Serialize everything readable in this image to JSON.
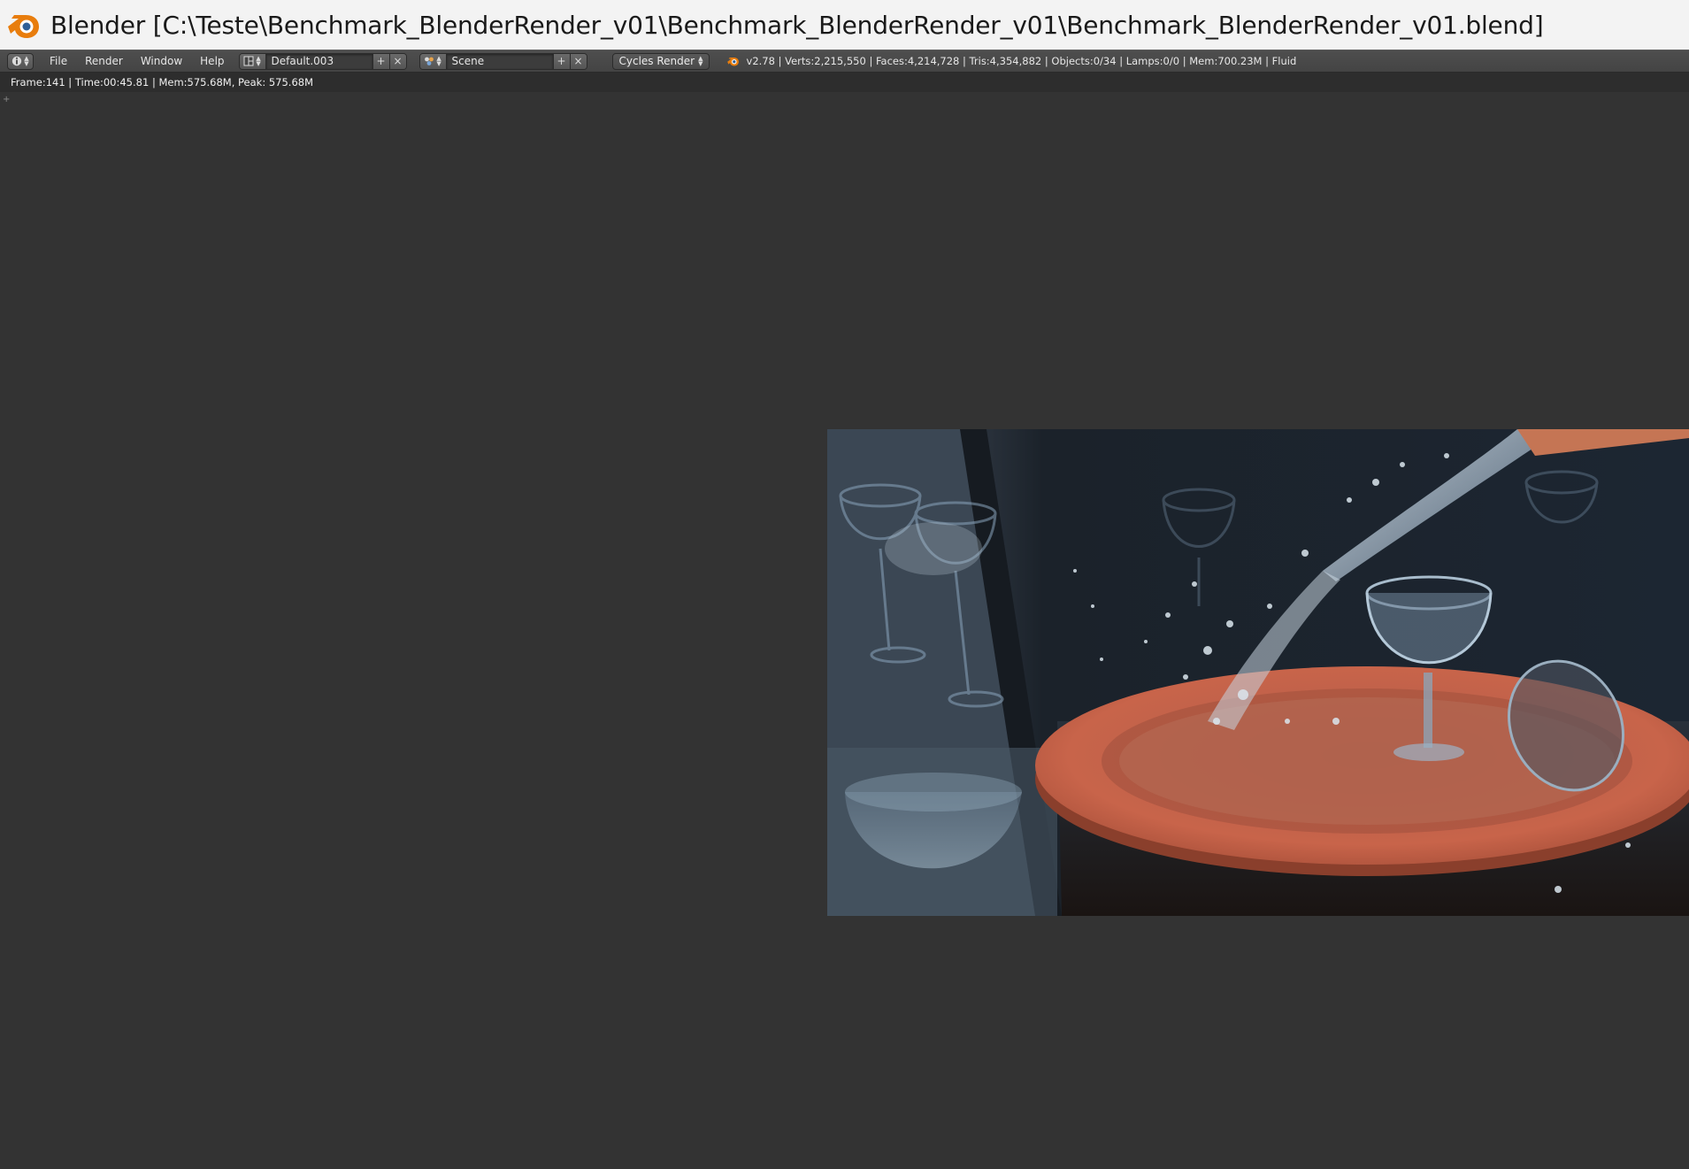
{
  "window": {
    "title": "Blender [C:\\Teste\\Benchmark_BlenderRender_v01\\Benchmark_BlenderRender_v01\\Benchmark_BlenderRender_v01.blend]",
    "icon": "blender-logo-icon"
  },
  "header": {
    "editor_type_icon": "info-editor-icon",
    "menus": [
      "File",
      "Render",
      "Window",
      "Help"
    ],
    "screen_layout": {
      "icon": "screen-layout-icon",
      "value": "Default.003"
    },
    "scene": {
      "icon": "scene-icon",
      "value": "Scene"
    },
    "render_engine": "Cycles Render",
    "stats": "v2.78 | Verts:2,215,550 | Faces:4,214,728 | Tris:4,354,882 | Objects:0/34 | Lamps:0/0 | Mem:700.23M | Fluid"
  },
  "render_status": "Frame:141 | Time:00:45.81 | Mem:575.68M, Peak: 575.68M",
  "render_result": {
    "description_icon": "render-result-image",
    "colors": {
      "plate": "#c8644a",
      "background": "#1e2a38",
      "glass": "#8aa4bc"
    }
  },
  "colors": {
    "titlebar_bg": "#f3f3f3",
    "header_bg": "#4a4a4a",
    "status_bg": "#2d2d2d",
    "viewport_bg": "#333333",
    "blender_orange": "#e87d0d"
  }
}
